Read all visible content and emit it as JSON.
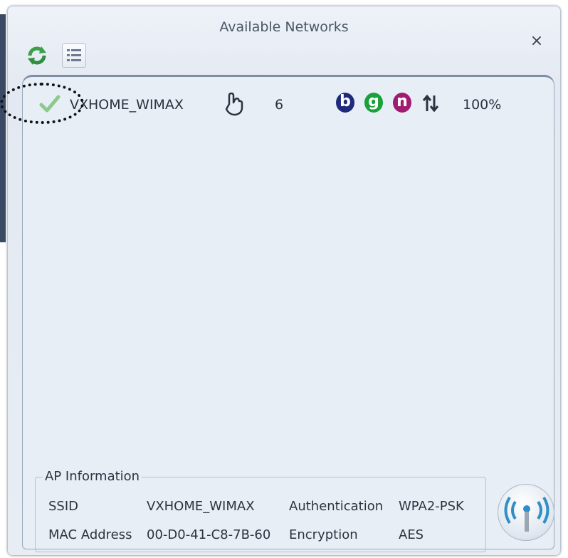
{
  "window": {
    "title": "Available Networks",
    "close_glyph": "×",
    "toolbar": {
      "refresh_icon": "refresh-icon",
      "list_icon": "list-icon"
    }
  },
  "networks": [
    {
      "ssid": "VXHOME_WIMAX",
      "connected": true,
      "channel": "6",
      "modes": [
        "b",
        "g",
        "n"
      ],
      "signal": "100%"
    }
  ],
  "ap_info": {
    "legend": "AP Information",
    "ssid_label": "SSID",
    "ssid_value": "VXHOME_WIMAX",
    "auth_label": "Authentication",
    "auth_value": "WPA2-PSK",
    "mac_label": "MAC Address",
    "mac_value": "00-D0-41-C8-7B-60",
    "enc_label": "Encryption",
    "enc_value": "AES"
  },
  "colors": {
    "mode_b": "#1f2a7c",
    "mode_g": "#1aa13a",
    "mode_n": "#a01c72",
    "accent": "#2f8fc6"
  }
}
